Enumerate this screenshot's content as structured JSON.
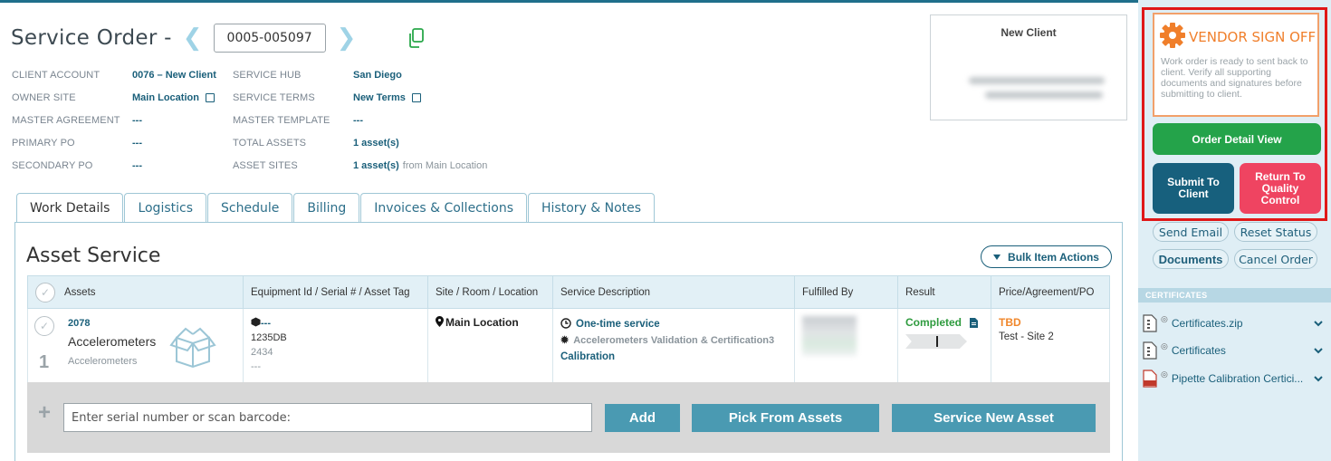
{
  "header": {
    "title": "Service Order -",
    "order_number": "0005-005097",
    "prev_arrow": "❮",
    "next_arrow": "❯"
  },
  "info": {
    "rows": [
      {
        "label": "CLIENT ACCOUNT",
        "value": "0076 – New Client",
        "label2": "SERVICE HUB",
        "value2": "San Diego"
      },
      {
        "label": "OWNER SITE",
        "value": "Main Location",
        "label2": "SERVICE TERMS",
        "value2": "New Terms"
      },
      {
        "label": "MASTER AGREEMENT",
        "value": "---",
        "label2": "MASTER TEMPLATE",
        "value2": "---"
      },
      {
        "label": "PRIMARY PO",
        "value": "---",
        "label2": "TOTAL ASSETS",
        "value2": "1 asset(s)"
      },
      {
        "label": "SECONDARY PO",
        "value": "---",
        "label2": "ASSET SITES",
        "value2": "1 asset(s)",
        "value2_suffix": "from Main Location"
      }
    ]
  },
  "client_card": {
    "name": "New Client"
  },
  "tabs": [
    "Work Details",
    "Logistics",
    "Schedule",
    "Billing",
    "Invoices & Collections",
    "History & Notes"
  ],
  "asset_service": {
    "title": "Asset Service",
    "bulk_label": "Bulk Item Actions",
    "columns": [
      "Assets",
      "Equipment Id / Serial # / Asset Tag",
      "Site / Room / Location",
      "Service Description",
      "Fulfilled By",
      "Result",
      "Price/Agreement/PO"
    ],
    "row": {
      "asset_id": "2078",
      "asset_name": "Accelerometers",
      "asset_sub": "Accelerometers",
      "row_num": "1",
      "equip_id": "---",
      "serial": "1235DB",
      "tag": "2434",
      "extra": "---",
      "location": "Main Location",
      "svc_type": "One-time service",
      "svc_name": "Accelerometers Validation & Certification3",
      "svc_cat": "Calibration",
      "result": "Completed",
      "price": "TBD",
      "agreement": "Test - Site 2"
    },
    "add_row": {
      "placeholder": "Enter serial number or scan barcode:",
      "add_label": "Add",
      "pick_label": "Pick From Assets",
      "new_label": "Service New Asset"
    }
  },
  "sidebar": {
    "vendor_title": "VENDOR SIGN OFF",
    "vendor_text": "Work order is ready to sent back to client. Verify all supporting documents and signatures before submitting to client.",
    "order_detail": "Order Detail View",
    "submit": "Submit To Client",
    "return": "Return To Quality Control",
    "send_email": "Send Email",
    "reset_status": "Reset Status",
    "documents": "Documents",
    "cancel_order": "Cancel Order",
    "cert_header": "CERTIFICATES",
    "certs": [
      "Certificates.zip",
      "Certificates",
      "Pipette Calibration Certici..."
    ]
  },
  "colors": {
    "accent": "#1a5f7a",
    "green": "#24a34a",
    "red": "#ef4461",
    "orange": "#f07f2b",
    "highlight_frame": "#e01818"
  }
}
